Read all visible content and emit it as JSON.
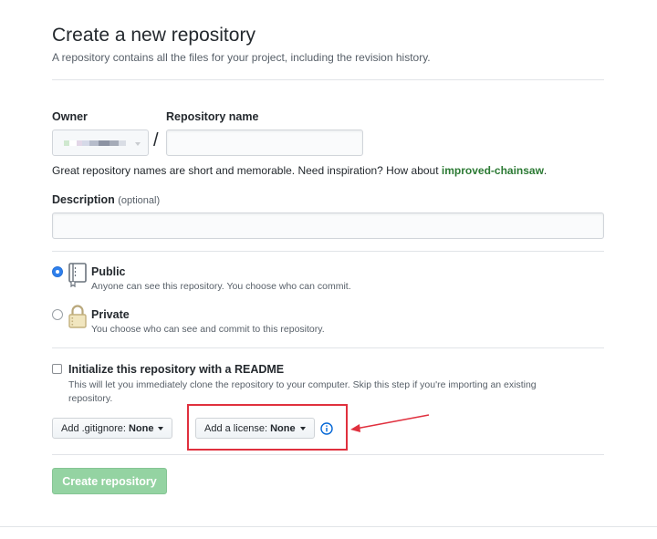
{
  "header": {
    "title": "Create a new repository",
    "subtitle": "A repository contains all the files for your project, including the revision history."
  },
  "owner": {
    "label": "Owner",
    "separator": "/"
  },
  "repository_name": {
    "label": "Repository name",
    "value": "",
    "placeholder": ""
  },
  "hint": {
    "text": "Great repository names are short and memorable. Need inspiration? How about ",
    "suggestion": "improved-chainsaw",
    "end": "."
  },
  "description": {
    "label": "Description",
    "optional": "(optional)",
    "value": "",
    "placeholder": ""
  },
  "visibility": {
    "selected": "public",
    "public": {
      "title": "Public",
      "desc": "Anyone can see this repository. You choose who can commit.",
      "icon": "repo-book-icon"
    },
    "private": {
      "title": "Private",
      "desc": "You choose who can see and commit to this repository.",
      "icon": "lock-icon"
    }
  },
  "readme": {
    "checked": false,
    "label": "Initialize this repository with a README",
    "desc_line1": "This will let you immediately clone the repository to your computer. Skip this step if you're importing an existing",
    "desc_line2": "repository."
  },
  "gitignore": {
    "prefix": "Add .gitignore:",
    "value": "None"
  },
  "license": {
    "prefix": "Add a license:",
    "value": "None",
    "info_icon": "info-icon"
  },
  "annotation": {
    "color": "#e0303e"
  },
  "submit": {
    "label": "Create repository",
    "color": "#94d3a2"
  }
}
